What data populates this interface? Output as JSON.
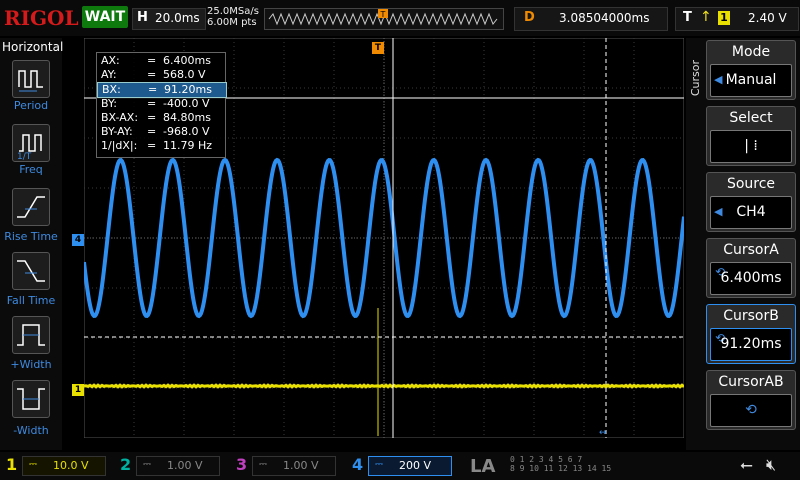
{
  "top": {
    "logo": "RIGOL",
    "run_state": "WAIT",
    "horiz_key": "H",
    "timebase": "20.0ms",
    "sample_rate": "25.0MSa/s",
    "memory_depth": "6.00M pts",
    "trig_marker": "T",
    "delay_key": "D",
    "delay": "3.08504000ms",
    "trig_key": "T",
    "trig_edge": "↑",
    "trig_source": "1",
    "trig_level": "2.40 V"
  },
  "left_panel": {
    "title": "Horizontal",
    "items": [
      {
        "label": "Period",
        "icon": "period-icon"
      },
      {
        "label": "Freq",
        "icon": "frequency-icon"
      },
      {
        "label": "Rise Time",
        "icon": "rise-time-icon"
      },
      {
        "label": "Fall Time",
        "icon": "fall-time-icon"
      },
      {
        "label": "+Width",
        "icon": "positive-width-icon"
      },
      {
        "label": "-Width",
        "icon": "negative-width-icon"
      }
    ]
  },
  "cursor_table": [
    {
      "key": "AX:",
      "eq": "=",
      "value": "6.400ms"
    },
    {
      "key": "AY:",
      "eq": "=",
      "value": "568.0 V"
    },
    {
      "key": "BX:",
      "eq": "=",
      "value": "91.20ms"
    },
    {
      "key": "BY:",
      "eq": "=",
      "value": "-400.0 V"
    },
    {
      "key": "BX-AX:",
      "eq": "=",
      "value": "84.80ms"
    },
    {
      "key": "BY-AY:",
      "eq": "=",
      "value": "-968.0 V"
    },
    {
      "key": "1/|dX|:",
      "eq": "=",
      "value": "11.79 Hz"
    }
  ],
  "right_panel": {
    "title": "Cursor",
    "mode": {
      "label": "Mode",
      "value": "Manual"
    },
    "select": {
      "label": "Select",
      "value": "|  ⁞"
    },
    "source": {
      "label": "Source",
      "value": "CH4"
    },
    "cursor_a": {
      "label": "CursorA",
      "value": "6.400ms"
    },
    "cursor_b": {
      "label": "CursorB",
      "value": "91.20ms"
    },
    "cursor_ab": {
      "label": "CursorAB",
      "value": "⟲"
    }
  },
  "waveform_markers": {
    "ch4": "4",
    "ch1": "1",
    "trig": "T"
  },
  "channels": [
    {
      "num": "1",
      "coupling": "⎓",
      "scale": "10.0 V",
      "color": "#e8e000",
      "active": true
    },
    {
      "num": "2",
      "coupling": "⎓",
      "scale": "1.00 V",
      "color": "#00b0a0",
      "active": false
    },
    {
      "num": "3",
      "coupling": "⎓",
      "scale": "1.00 V",
      "color": "#c040c0",
      "active": false
    },
    {
      "num": "4",
      "coupling": "⎓",
      "scale": "200 V",
      "color": "#2f8ff0",
      "active": true
    }
  ],
  "bottom": {
    "la": "LA",
    "bits_row1": "0 1 2 3   4 5 6 7",
    "bits_row2": "8 9 10 11 12 13 14 15",
    "usb_icon": "usb-icon",
    "speaker_icon": "speaker-mute-icon"
  }
}
